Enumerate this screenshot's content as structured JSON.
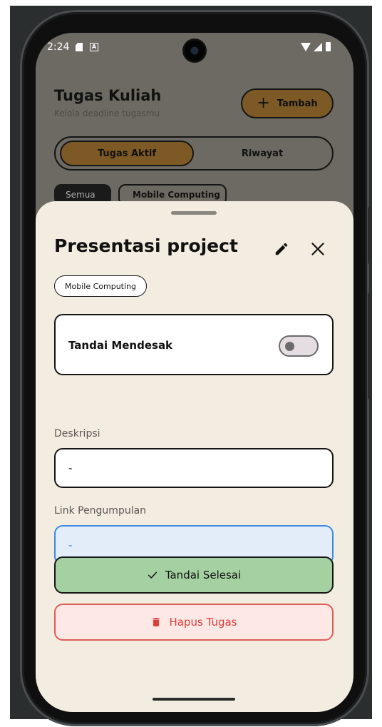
{
  "status_bar": {
    "time": "2:24"
  },
  "background": {
    "title": "Tugas Kuliah",
    "subtitle": "Kelola deadline tugasmu",
    "add_button": "Tambah",
    "tabs": [
      {
        "label": "Tugas Aktif"
      },
      {
        "label": "Riwayat"
      }
    ],
    "filters": [
      {
        "label": "Semua"
      },
      {
        "label": "Mobile Computing"
      }
    ]
  },
  "sheet": {
    "title": "Presentasi project",
    "course": "Mobile Computing",
    "urgent_label": "Tandai Mendesak",
    "urgent_on": false,
    "description_label": "Deskripsi",
    "description_value": "-",
    "link_label": "Link Pengumpulan",
    "link_value": "-",
    "done_button": "Tandai Selesai",
    "delete_button": "Hapus Tugas"
  },
  "colors": {
    "sheet_bg": "#f3ede1",
    "accent": "#7d5a25",
    "done": "#a4d0a2",
    "delete": "#dc3f3a",
    "link_focus": "#3b8ae6"
  }
}
